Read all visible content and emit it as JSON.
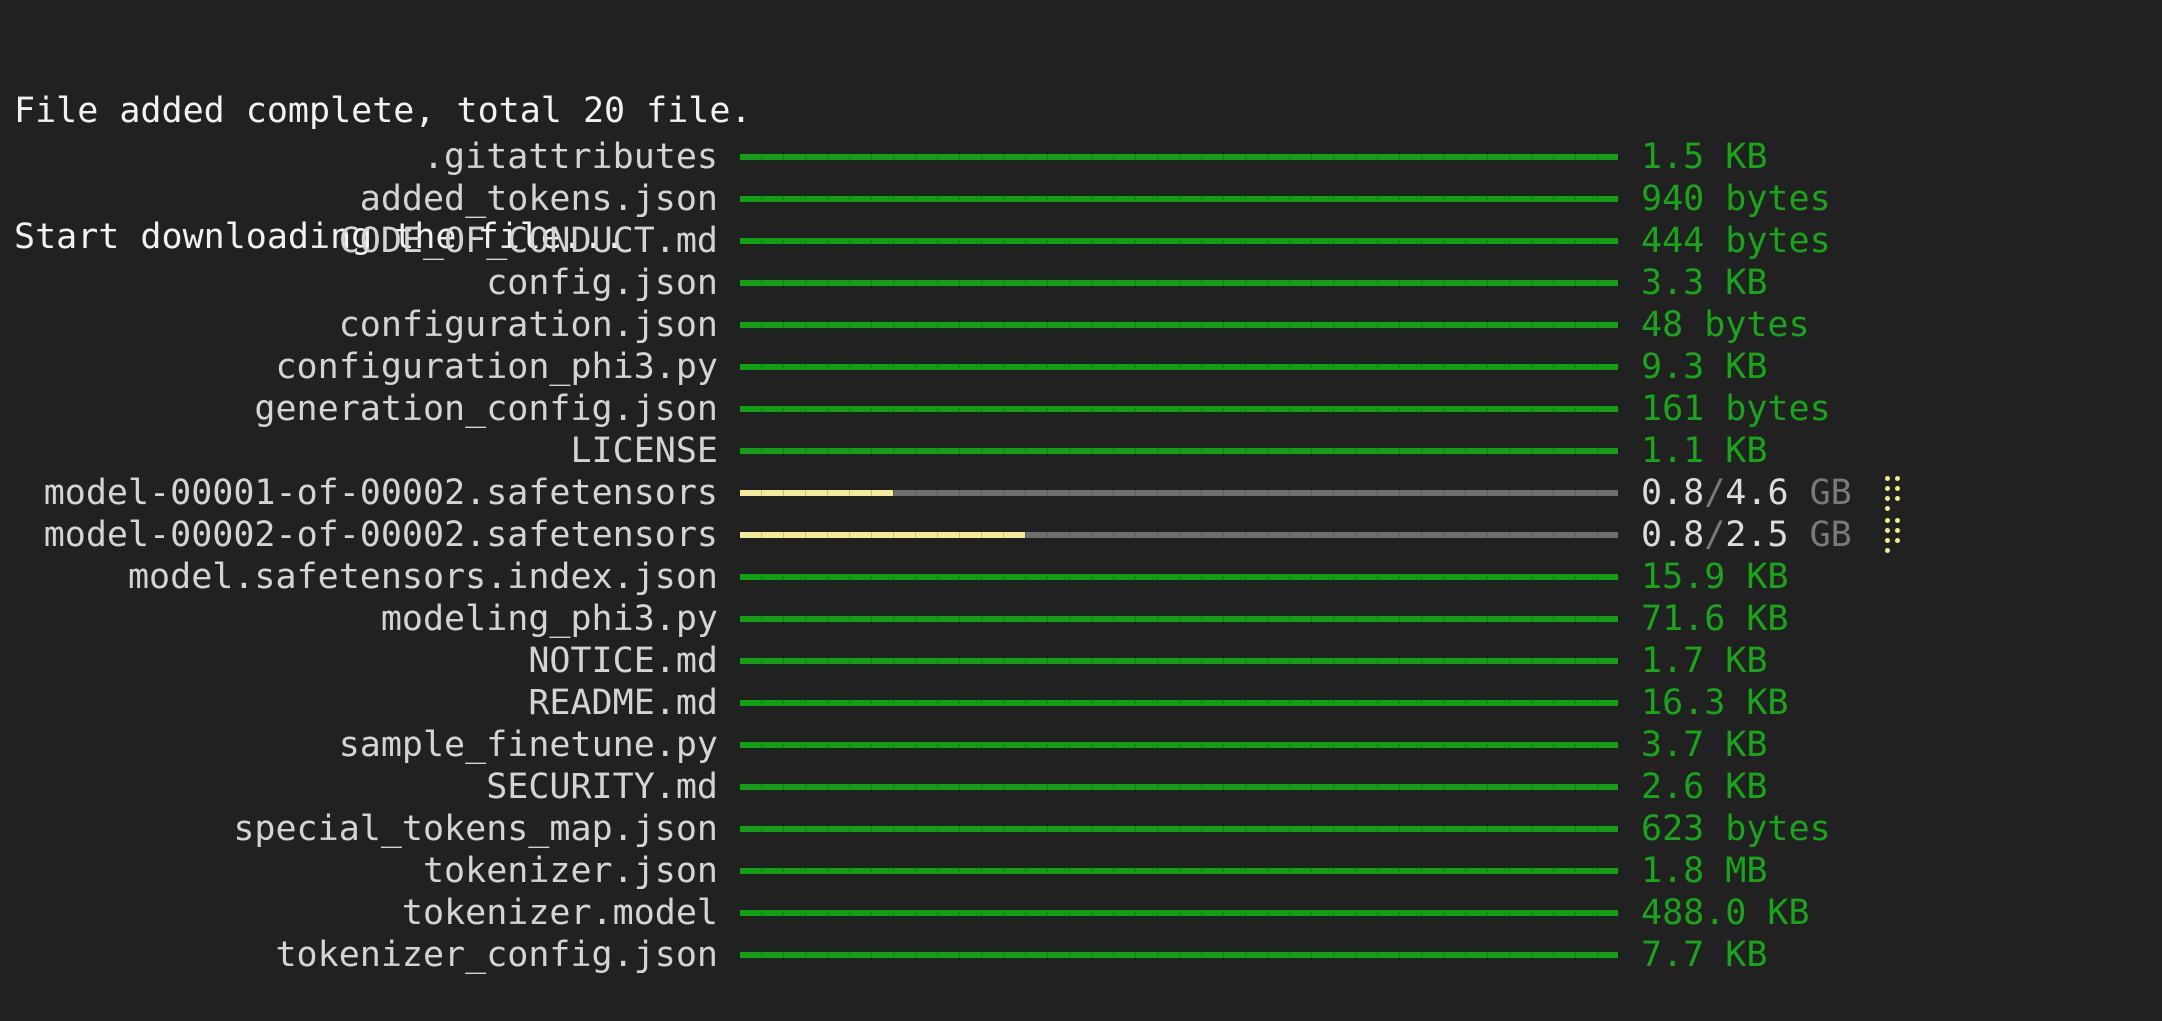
{
  "header": {
    "line1": "File added complete, total 20 file.",
    "line2": "Start downloading the file..."
  },
  "colors": {
    "background": "#212121",
    "complete_bar": "#14a014",
    "complete_size": "#17a617",
    "partial_bar": "#f5eb9a",
    "remaining_bar": "#6e6e6e",
    "spinner": "#f5eb8a"
  },
  "files": [
    {
      "name": ".gitattributes",
      "status": "complete",
      "size": "1.5 KB",
      "progress": 1.0
    },
    {
      "name": "added_tokens.json",
      "status": "complete",
      "size": "940 bytes",
      "progress": 1.0
    },
    {
      "name": "CODE_OF_CONDUCT.md",
      "status": "complete",
      "size": "444 bytes",
      "progress": 1.0
    },
    {
      "name": "config.json",
      "status": "complete",
      "size": "3.3 KB",
      "progress": 1.0
    },
    {
      "name": "configuration.json",
      "status": "complete",
      "size": "48 bytes",
      "progress": 1.0
    },
    {
      "name": "configuration_phi3.py",
      "status": "complete",
      "size": "9.3 KB",
      "progress": 1.0
    },
    {
      "name": "generation_config.json",
      "status": "complete",
      "size": "161 bytes",
      "progress": 1.0
    },
    {
      "name": "LICENSE",
      "status": "complete",
      "size": "1.1 KB",
      "progress": 1.0
    },
    {
      "name": "model-00001-of-00002.safetensors",
      "status": "downloading",
      "downloaded": "0.8",
      "total": "4.6",
      "unit": "GB",
      "progress": 0.174,
      "spinner_icon": "braille-spinner-icon"
    },
    {
      "name": "model-00002-of-00002.safetensors",
      "status": "downloading",
      "downloaded": "0.8",
      "total": "2.5",
      "unit": "GB",
      "progress": 0.325,
      "spinner_icon": "braille-spinner-icon"
    },
    {
      "name": "model.safetensors.index.json",
      "status": "complete",
      "size": "15.9 KB",
      "progress": 1.0
    },
    {
      "name": "modeling_phi3.py",
      "status": "complete",
      "size": "71.6 KB",
      "progress": 1.0
    },
    {
      "name": "NOTICE.md",
      "status": "complete",
      "size": "1.7 KB",
      "progress": 1.0
    },
    {
      "name": "README.md",
      "status": "complete",
      "size": "16.3 KB",
      "progress": 1.0
    },
    {
      "name": "sample_finetune.py",
      "status": "complete",
      "size": "3.7 KB",
      "progress": 1.0
    },
    {
      "name": "SECURITY.md",
      "status": "complete",
      "size": "2.6 KB",
      "progress": 1.0
    },
    {
      "name": "special_tokens_map.json",
      "status": "complete",
      "size": "623 bytes",
      "progress": 1.0
    },
    {
      "name": "tokenizer.json",
      "status": "complete",
      "size": "1.8 MB",
      "progress": 1.0
    },
    {
      "name": "tokenizer.model",
      "status": "complete",
      "size": "488.0 KB",
      "progress": 1.0
    },
    {
      "name": "tokenizer_config.json",
      "status": "complete",
      "size": "7.7 KB",
      "progress": 1.0
    }
  ]
}
